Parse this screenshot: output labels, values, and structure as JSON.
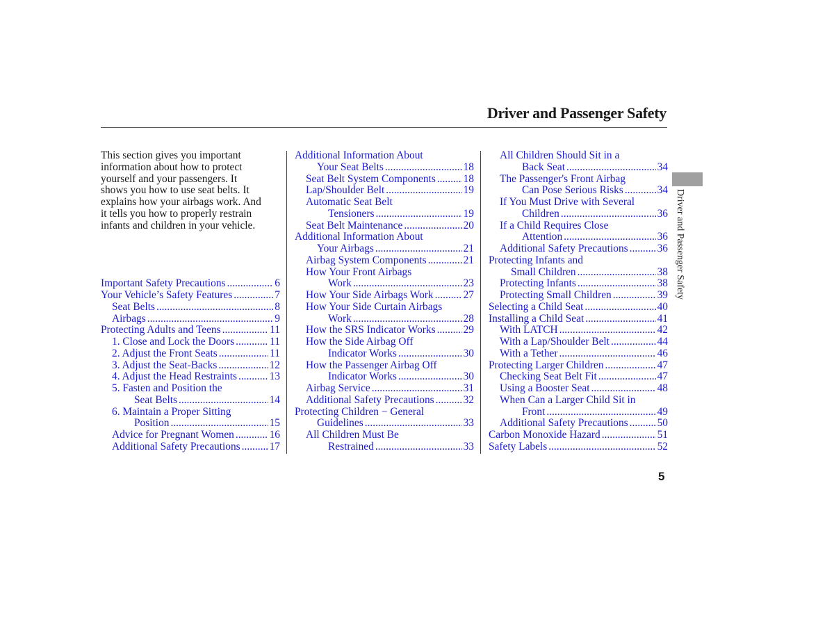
{
  "header": {
    "title": "Driver and Passenger Safety",
    "side_tab_label": "Driver and Passenger Safety",
    "page_number": "5"
  },
  "intro": {
    "lines": [
      "This section gives you important",
      "information about how to protect",
      "yourself and your passengers. It",
      "shows you how to use seat belts. It",
      "explains how your airbags work. And",
      "it tells you how to properly restrain",
      "infants and children in your vehicle."
    ]
  },
  "colors": {
    "link": "#1c1cc8",
    "text": "#1a1a1a",
    "side_tab": "#a0a0a0"
  },
  "toc": {
    "column1": [
      {
        "title": "Important Safety Precautions",
        "page": "6",
        "level": 0
      },
      {
        "title": "Your Vehicle’s Safety Features",
        "page": "7",
        "level": 0
      },
      {
        "title": "Seat Belts",
        "page": "8",
        "level": 1
      },
      {
        "title": "Airbags",
        "page": "9",
        "level": 1
      },
      {
        "title": "Protecting Adults and Teens",
        "page": "11",
        "level": 0
      },
      {
        "title": "1. Close and Lock the Doors",
        "page": "11",
        "level": 1
      },
      {
        "title": "2. Adjust the Front Seats",
        "page": "11",
        "level": 1
      },
      {
        "title": "3. Adjust the Seat-Backs",
        "page": "12",
        "level": 1
      },
      {
        "title": "4. Adjust the Head Restraints",
        "page": "13",
        "level": 1
      },
      {
        "title": "5. Fasten and Position the",
        "continuation": "Seat Belts",
        "page": "14",
        "level": 1
      },
      {
        "title": "6. Maintain a Proper Sitting",
        "continuation": "Position",
        "page": "15",
        "level": 1
      },
      {
        "title": "Advice for Pregnant Women",
        "page": "16",
        "level": 1
      },
      {
        "title": "Additional Safety Precautions",
        "page": "17",
        "level": 1
      }
    ],
    "column2": [
      {
        "title": "Additional Information About",
        "continuation": "Your Seat Belts",
        "page": "18",
        "level": 0
      },
      {
        "title": "Seat Belt System Components",
        "page": "18",
        "level": 1
      },
      {
        "title": "Lap/Shoulder Belt",
        "page": "19",
        "level": 1
      },
      {
        "title": "Automatic Seat Belt",
        "continuation": "Tensioners",
        "page": "19",
        "level": 1
      },
      {
        "title": "Seat Belt Maintenance",
        "page": "20",
        "level": 1
      },
      {
        "title": "Additional Information About",
        "continuation": "Your Airbags",
        "page": "21",
        "level": 0
      },
      {
        "title": "Airbag System Components",
        "page": "21",
        "level": 1
      },
      {
        "title": "How Your Front Airbags",
        "continuation": "Work",
        "page": "23",
        "level": 1
      },
      {
        "title": "How Your Side Airbags Work",
        "page": "27",
        "level": 1
      },
      {
        "title": "How Your Side Curtain Airbags",
        "continuation": "Work",
        "page": "28",
        "level": 1
      },
      {
        "title": "How the SRS Indicator Works",
        "page": "29",
        "level": 1
      },
      {
        "title": "How the Side Airbag Off",
        "continuation": "Indicator Works",
        "page": "30",
        "level": 1
      },
      {
        "title": "How the Passenger Airbag Off",
        "continuation": "Indicator Works",
        "page": "30",
        "level": 1
      },
      {
        "title": "Airbag Service",
        "page": "31",
        "level": 1
      },
      {
        "title": "Additional Safety Precautions",
        "page": "32",
        "level": 1
      },
      {
        "title": "Protecting Children − General",
        "continuation": "Guidelines",
        "page": "33",
        "level": 0
      },
      {
        "title": "All Children Must Be",
        "continuation": "Restrained",
        "page": "33",
        "level": 1
      }
    ],
    "column3": [
      {
        "title": "All Children Should Sit in a",
        "continuation": "Back Seat",
        "page": "34",
        "level": 1
      },
      {
        "title": "The Passenger's Front Airbag",
        "continuation": "Can Pose Serious Risks",
        "page": "34",
        "level": 1
      },
      {
        "title": "If You Must Drive with Several",
        "continuation": "Children",
        "page": "36",
        "level": 1
      },
      {
        "title": "If a Child Requires Close",
        "continuation": "Attention",
        "page": "36",
        "level": 1
      },
      {
        "title": "Additional Safety Precautions",
        "page": "36",
        "level": 1
      },
      {
        "title": "Protecting Infants and",
        "continuation": "Small Children",
        "page": "38",
        "level": 0
      },
      {
        "title": "Protecting Infants",
        "page": "38",
        "level": 1
      },
      {
        "title": "Protecting Small Children",
        "page": "39",
        "level": 1
      },
      {
        "title": "Selecting a Child Seat",
        "page": "40",
        "level": 0
      },
      {
        "title": "Installing a Child Seat",
        "page": "41",
        "level": 0
      },
      {
        "title": "With LATCH",
        "page": "42",
        "level": 1
      },
      {
        "title": "With a Lap/Shoulder Belt",
        "page": "44",
        "level": 1
      },
      {
        "title": "With a Tether",
        "page": "46",
        "level": 1
      },
      {
        "title": "Protecting Larger Children",
        "page": "47",
        "level": 0
      },
      {
        "title": "Checking Seat Belt Fit",
        "page": "47",
        "level": 1
      },
      {
        "title": "Using a Booster Seat",
        "page": "48",
        "level": 1
      },
      {
        "title": "When Can a Larger Child Sit in",
        "continuation": "Front",
        "page": "49",
        "level": 1
      },
      {
        "title": "Additional Safety Precautions",
        "page": "50",
        "level": 1
      },
      {
        "title": "Carbon Monoxide Hazard",
        "page": "51",
        "level": 0
      },
      {
        "title": "Safety Labels",
        "page": "52",
        "level": 0
      }
    ]
  }
}
